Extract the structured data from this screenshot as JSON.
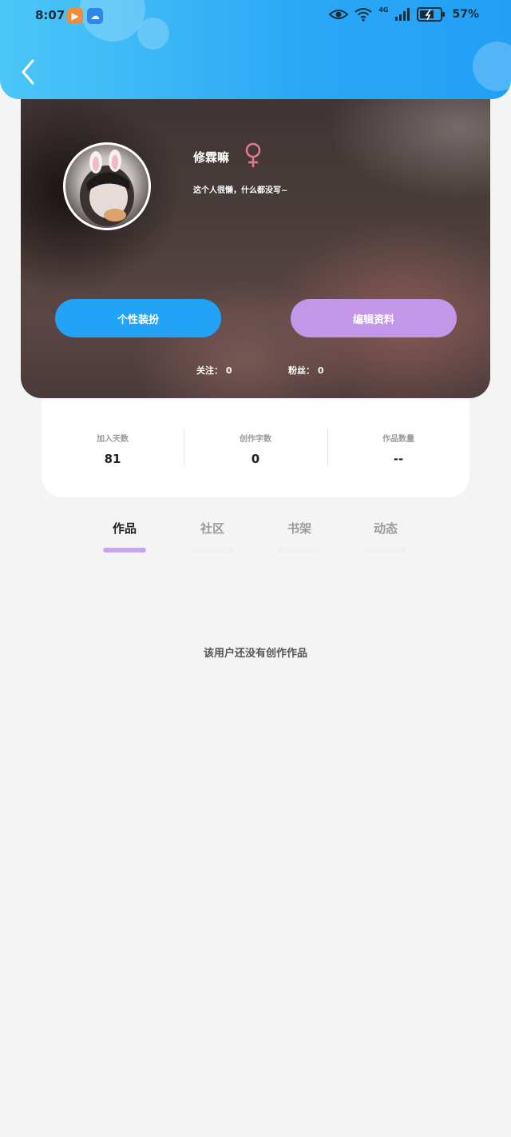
{
  "status_bar": {
    "time": "8:07",
    "network": "4G",
    "battery": "57%"
  },
  "colors": {
    "header_start": "#4cc6f7",
    "header_end": "#22a0f5",
    "primary_button": "#22a3f6",
    "secondary_button": "#c297e8",
    "gender_female": "#e07a8a",
    "tab_active_underline": "#c8a6ee"
  },
  "header": {
    "back_icon": "chevron-left-icon"
  },
  "profile": {
    "username": "修霖嘛",
    "gender_icon": "female-symbol-icon",
    "bio": "这个人很懒，什么都没写~",
    "dress_up_label": "个性装扮",
    "edit_profile_label": "编辑资料",
    "following_text": "关注：  0",
    "followers_text": "粉丝：  0"
  },
  "stats": [
    {
      "label": "加入天数",
      "value": "81"
    },
    {
      "label": "创作字数",
      "value": "0"
    },
    {
      "label": "作品数量",
      "value": "--"
    }
  ],
  "tabs": [
    {
      "label": "作品",
      "active": true
    },
    {
      "label": "社区",
      "active": false
    },
    {
      "label": "书架",
      "active": false
    },
    {
      "label": "动态",
      "active": false
    }
  ],
  "empty_state": "该用户还没有创作作品"
}
